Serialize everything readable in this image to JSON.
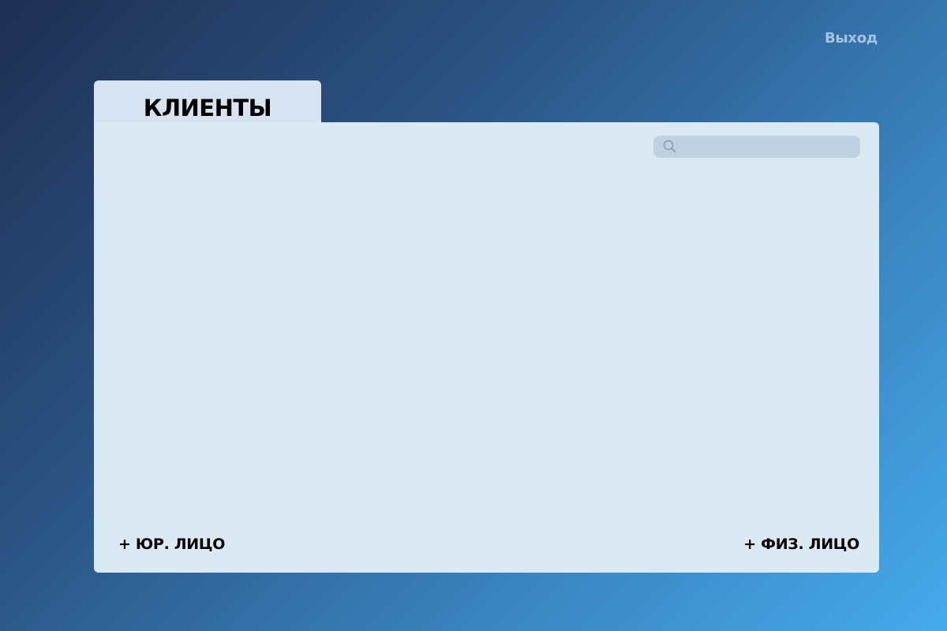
{
  "header": {
    "logout_label": "Выход"
  },
  "tab": {
    "title": "КЛИЕНТЫ"
  },
  "search": {
    "value": "",
    "placeholder": "",
    "icon": "search-icon"
  },
  "actions": {
    "add_legal_entity_label": "+ ЮР. ЛИЦО",
    "add_individual_label": "+ ФИЗ. ЛИЦО"
  },
  "colors": {
    "background_start": "#1f2f53",
    "background_end": "#45aaec",
    "panel": "#dbe9f4",
    "tab": "#d6e3f0",
    "search_field": "#bfd1e0",
    "logout_text": "#a4c2e2"
  }
}
